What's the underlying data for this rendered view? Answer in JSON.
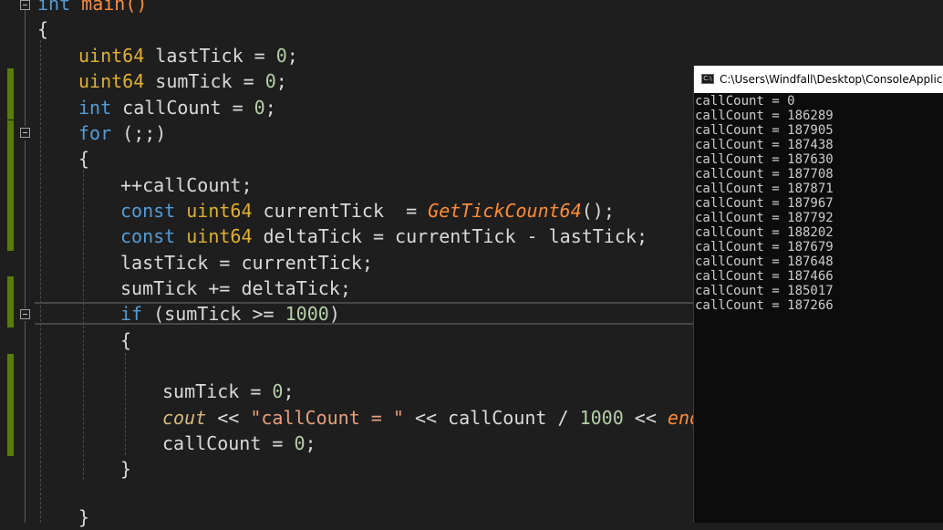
{
  "editor": {
    "lines": {
      "l0": {
        "kw": "int",
        "rest": " main()"
      },
      "l1": {
        "brace": "{"
      },
      "l2": {
        "type": "uint64",
        "rest": " lastTick = ",
        "num": "0",
        "end": ";"
      },
      "l3": {
        "type": "uint64",
        "rest": " sumTick = ",
        "num": "0",
        "end": ";"
      },
      "l4": {
        "kw": "int",
        "rest": " callCount = ",
        "num": "0",
        "end": ";"
      },
      "l5": {
        "kw": "for",
        "rest": " (;;)"
      },
      "l6": {
        "brace": "{"
      },
      "l7": {
        "text": "++callCount;"
      },
      "l8": {
        "kw": "const",
        "type": "uint64",
        "rest": " currentTick  = ",
        "fn": "GetTickCount64",
        "end": "();"
      },
      "l9": {
        "kw": "const",
        "type": "uint64",
        "rest": " deltaTick = currentTick - lastTick;"
      },
      "l10": {
        "text": "lastTick = currentTick;"
      },
      "l11": {
        "text": "sumTick += deltaTick;"
      },
      "l12": {
        "kw": "if",
        "rest": " (sumTick >= ",
        "num": "1000",
        "end": ")"
      },
      "l13": {
        "brace": "{"
      },
      "l14": {
        "rest": "sumTick = ",
        "num": "0",
        "end": ";"
      },
      "l15": {
        "cout": "cout",
        "op1": " << ",
        "str": "\"callCount = \"",
        "mid": " << callCount / ",
        "num": "1000",
        "op2": " << ",
        "endl": "endl",
        "end": ";"
      },
      "l16": {
        "rest": "callCount = ",
        "num": "0",
        "end": ";"
      },
      "l17": {
        "brace": "}"
      },
      "l18": {
        "brace": "}"
      }
    }
  },
  "console": {
    "title": "C:\\Users\\Windfall\\Desktop\\ConsoleApplication",
    "icon": "console-app-icon",
    "output": [
      "callCount = 0",
      "callCount = 186289",
      "callCount = 187905",
      "callCount = 187438",
      "callCount = 187630",
      "callCount = 187708",
      "callCount = 187871",
      "callCount = 187967",
      "callCount = 187792",
      "callCount = 188202",
      "callCount = 187679",
      "callCount = 187648",
      "callCount = 187466",
      "callCount = 185017",
      "callCount = 187266"
    ]
  }
}
